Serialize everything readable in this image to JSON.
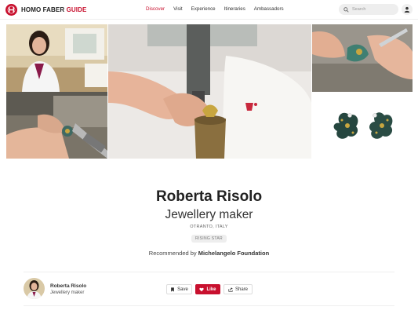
{
  "brand": {
    "name_part1": "HOMO FABER",
    "name_part2": "GUIDE",
    "accent_color": "#c8102e"
  },
  "nav": {
    "items": [
      {
        "label": "Discover",
        "active": true
      },
      {
        "label": "Visit",
        "active": false
      },
      {
        "label": "Experience",
        "active": false
      },
      {
        "label": "Itineraries",
        "active": false
      },
      {
        "label": "Ambassadors",
        "active": false
      }
    ]
  },
  "search": {
    "placeholder": "Search",
    "icon": "search-icon"
  },
  "user": {
    "icon": "user-icon"
  },
  "gallery": {
    "images": [
      {
        "subject": "portrait of artisan in workshop"
      },
      {
        "subject": "hands polishing a ring"
      },
      {
        "subject": "hands engraving jewellery piece"
      },
      {
        "subject": "hands painting enamel piece"
      },
      {
        "subject": "pair of enamel flower earrings"
      }
    ]
  },
  "profile": {
    "name": "Roberta Risolo",
    "profession": "Jewellery maker",
    "location": "OTRANTO, ITALY",
    "badge": "RISING STAR",
    "recommended_prefix": "Recommended by",
    "recommended_by": "Michelangelo Foundation"
  },
  "actions": {
    "save_label": "Save",
    "like_label": "Like",
    "share_label": "Share",
    "like_color": "#c8102e"
  },
  "bar": {
    "name": "Roberta Risolo",
    "profession": "Jewellery maker"
  }
}
